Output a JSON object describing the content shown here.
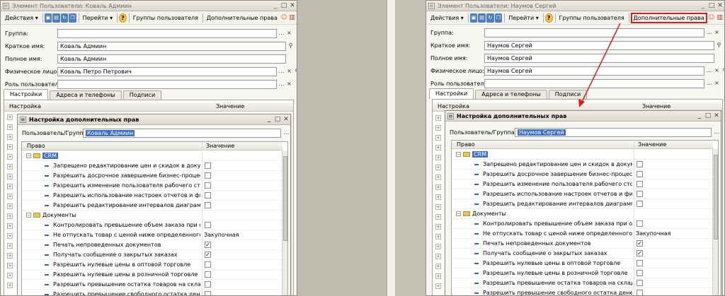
{
  "left": {
    "window_title": "Элемент Пользователи: Коваль Адмиин",
    "toolbar": {
      "actions": "Действия",
      "goto": "Перейти",
      "groups": "Группы пользователя",
      "extra_rights": "Дополнительные права"
    },
    "fields": [
      {
        "label": "Группа:",
        "value": ""
      },
      {
        "label": "Краткое имя:",
        "value": "Коваль Адмиин"
      },
      {
        "label": "Полное имя:",
        "value": "Коваль Адмиин"
      },
      {
        "label": "Физическое лицо:",
        "value": "Коваль Петро Петрович"
      },
      {
        "label": "Роль пользователя:",
        "value": ""
      }
    ],
    "tabs": [
      "Настройки",
      "Адреса и телефоны",
      "Подписи"
    ],
    "grid_headers": {
      "setting": "Настройка",
      "value": "Значение"
    },
    "dialog": {
      "title": "Настройка дополнительных прав",
      "user_label": "Пользователь/Группа:",
      "user_value": "Коваль Адмиин",
      "col_right": "Право",
      "col_value": "Значение"
    }
  },
  "right": {
    "window_title": "Элемент Пользователи: Наумов Сергей",
    "toolbar": {
      "actions": "Действия",
      "goto": "Перейти",
      "groups": "Группы пользователя",
      "extra_rights": "Дополнительные права"
    },
    "fields": [
      {
        "label": "Группа:",
        "value": ""
      },
      {
        "label": "Краткое имя:",
        "value": "Наумов Сергей"
      },
      {
        "label": "Полное имя:",
        "value": "Наумов Сергей"
      },
      {
        "label": "Физическое лицо:",
        "value": "Наумов Сергей"
      },
      {
        "label": "Роль пользователя:",
        "value": ""
      }
    ],
    "tabs": [
      "Настройки",
      "Адреса и телефоны",
      "Подписи"
    ],
    "grid_headers": {
      "setting": "Настройка",
      "value": "Значение"
    },
    "dialog": {
      "title": "Настройка дополнительных прав",
      "user_label": "Пользователь/Группа:",
      "user_value": "Наумов Сергей",
      "col_right": "Право",
      "col_value": "Значение"
    }
  },
  "rights_tree": [
    {
      "type": "group",
      "name": "CRM",
      "selected": true
    },
    {
      "type": "item",
      "name": "Запрещено редактирование цен и скидок в документ...",
      "value": "checkbox",
      "checked": false
    },
    {
      "type": "item",
      "name": "Разрешить досрочное завершение бизнес-процесса",
      "value": "checkbox",
      "checked": false
    },
    {
      "type": "item",
      "name": "Разрешить изменение пользователя рабочего стола ...",
      "value": "checkbox",
      "checked": false
    },
    {
      "type": "item",
      "name": "Разрешить использование  настроек отчетов и фильт...",
      "value": "checkbox",
      "checked": false
    },
    {
      "type": "item",
      "name": "Разрешить редактирование интервалов диаграммы Г...",
      "value": "checkbox",
      "checked": false
    },
    {
      "type": "group",
      "name": "Документы",
      "selected": false
    },
    {
      "type": "item",
      "name": "Контролировать превышение объем заказа при отгр...",
      "value": "checkbox",
      "checked": false
    },
    {
      "type": "item",
      "name": "Не отпускать товар с ценой ниже определенного типа",
      "value": "text",
      "text": "Закупочная"
    },
    {
      "type": "item",
      "name": "Печать непроведенных документов",
      "value": "checkbox",
      "checked": true
    },
    {
      "type": "item",
      "name": "Получать сообщение о закрытых заказах",
      "value": "checkbox",
      "checked": true
    },
    {
      "type": "item",
      "name": "Разрешить нулевые цены в оптовой торговле",
      "value": "checkbox",
      "checked": false
    },
    {
      "type": "item",
      "name": "Разрешить нулевые цены в розничной торговле",
      "value": "checkbox",
      "checked": false
    },
    {
      "type": "item",
      "name": "Разрешить превышение остатка товаров на складе",
      "value": "checkbox",
      "checked": false
    },
    {
      "type": "item",
      "name": "Разрешить превышение свободного остатка денежн...",
      "value": "checkbox",
      "checked": false
    }
  ],
  "left_tree_names": [
    "CRM",
    "Запрещено редактирование цен и скидок в документ...",
    "Разрешить досрочное завершение бизнес-процесса",
    "Разрешить изменение пользователя рабочего стола ...",
    "Разрешить использование  настроек отчетов и фильт...",
    "Разрешить редактирование интервалов диаграммы Г...",
    "Документы",
    "Контролировать превышение объем заказа при отгр...",
    "Не отпускать товар с ценой ниже определенного типа",
    "Печать непроведенных документов",
    "Получать сообщение о закрытых заказах",
    "Разрешить нулевые цены в оптовой торговле",
    "Разрешить нулевые цены в розничной торговле",
    "Разрешить превышение остатка товаров на складе",
    "Разрешить превышение свободного остатка денежн..."
  ],
  "colors": {
    "highlight_red": "#d41f1f",
    "selection_blue": "#3d6fc4",
    "window_bg": "#f7f6f1"
  }
}
